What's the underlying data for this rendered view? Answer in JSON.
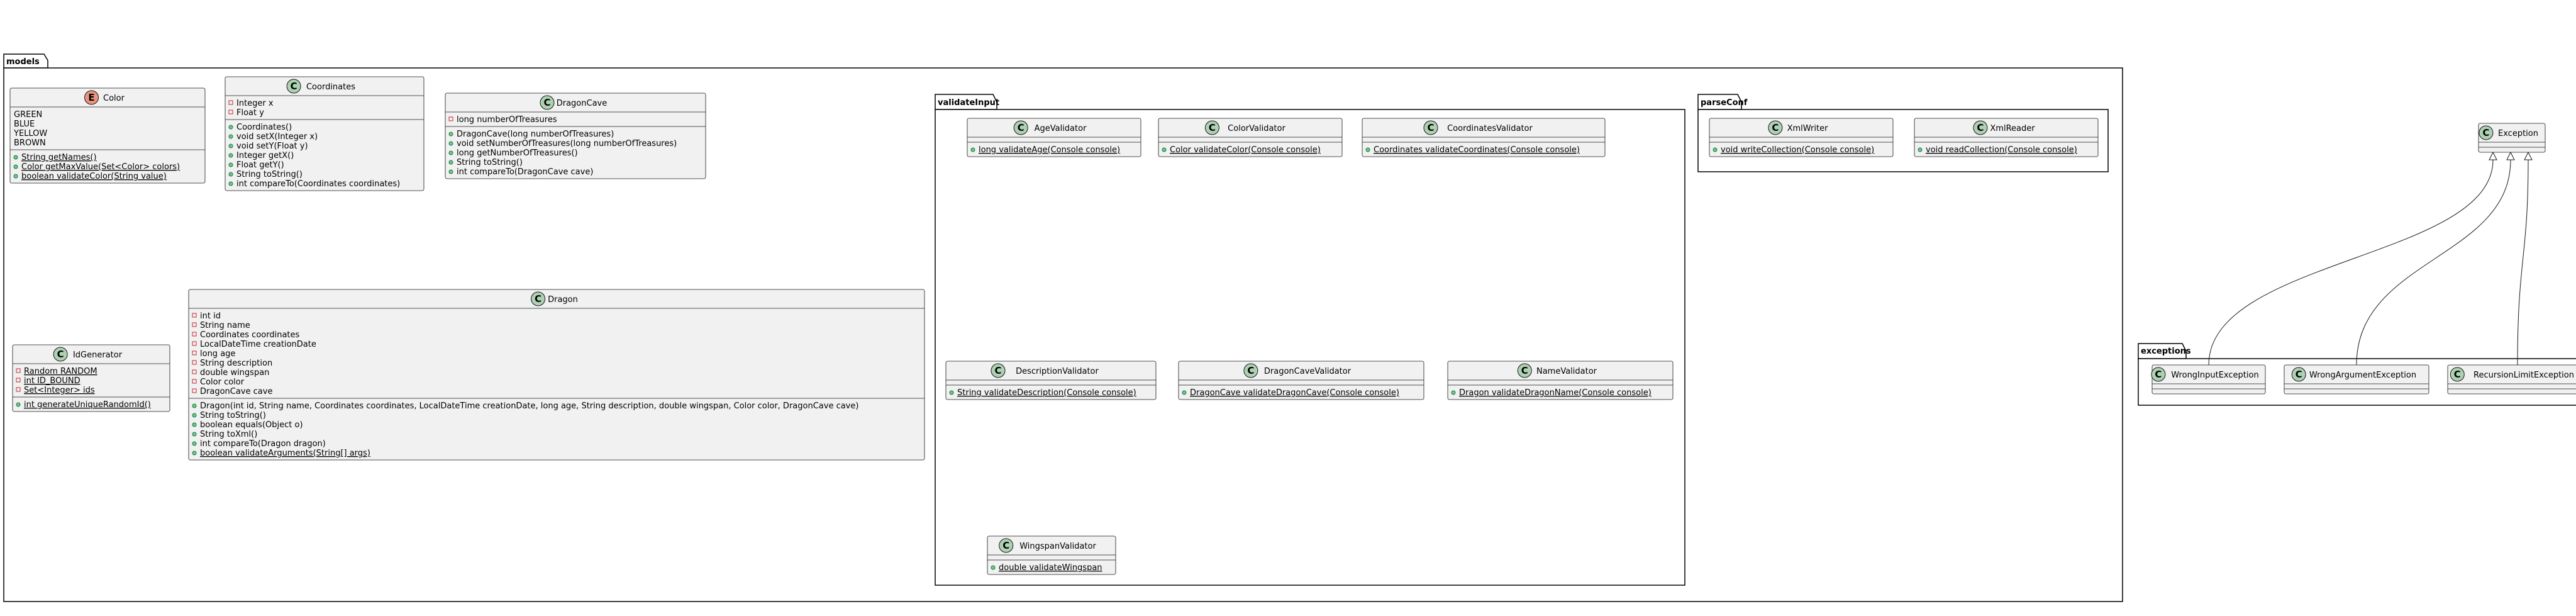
{
  "packages": {
    "models": "models",
    "validateInput": "validateInput",
    "parseConf": "parseConf",
    "exceptions": "exceptions"
  },
  "classes": [
    {
      "id": "color",
      "name": "Color",
      "kind": "enum",
      "members": [
        {
          "vis": "",
          "text": "GREEN"
        },
        {
          "vis": "",
          "text": "BLUE"
        },
        {
          "vis": "",
          "text": "YELLOW"
        },
        {
          "vis": "",
          "text": "BROWN"
        }
      ],
      "methods": [
        {
          "vis": "+",
          "text": "String getNames()",
          "static": true
        },
        {
          "vis": "+",
          "text": "Color getMaxValue(Set<Color> colors)",
          "static": true
        },
        {
          "vis": "+",
          "text": "boolean validateColor(String value)",
          "static": true
        }
      ]
    },
    {
      "id": "coordinates",
      "name": "Coordinates",
      "kind": "class",
      "members": [
        {
          "vis": "-",
          "text": "Integer x"
        },
        {
          "vis": "-",
          "text": "Float y"
        }
      ],
      "methods": [
        {
          "vis": "+",
          "text": "Coordinates()"
        },
        {
          "vis": "+",
          "text": "void setX(Integer x)"
        },
        {
          "vis": "+",
          "text": "void setY(Float y)"
        },
        {
          "vis": "+",
          "text": "Integer getX()"
        },
        {
          "vis": "+",
          "text": "Float getY()"
        },
        {
          "vis": "+",
          "text": "String toString()"
        },
        {
          "vis": "+",
          "text": "int compareTo(Coordinates coordinates)"
        }
      ]
    },
    {
      "id": "dragoncave",
      "name": "DragonCave",
      "kind": "class",
      "members": [
        {
          "vis": "-",
          "text": "long numberOfTreasures"
        }
      ],
      "methods": [
        {
          "vis": "+",
          "text": "DragonCave(long numberOfTreasures)"
        },
        {
          "vis": "+",
          "text": "void setNumberOfTreasures(long numberOfTreasures)"
        },
        {
          "vis": "+",
          "text": "long getNumberOfTreasures()"
        },
        {
          "vis": "+",
          "text": "String toString()"
        },
        {
          "vis": "+",
          "text": "int compareTo(DragonCave cave)"
        }
      ]
    },
    {
      "id": "idgenerator",
      "name": "IdGenerator",
      "kind": "class",
      "members": [
        {
          "vis": "-",
          "text": "Random RANDOM",
          "static": true
        },
        {
          "vis": "-",
          "text": "int ID_BOUND",
          "static": true
        },
        {
          "vis": "-",
          "text": "Set<Integer> ids",
          "static": true
        }
      ],
      "methods": [
        {
          "vis": "+",
          "text": "int generateUniqueRandomId()",
          "static": true
        }
      ]
    },
    {
      "id": "dragon",
      "name": "Dragon",
      "kind": "class",
      "members": [
        {
          "vis": "-",
          "text": "int id"
        },
        {
          "vis": "-",
          "text": "String name"
        },
        {
          "vis": "-",
          "text": "Coordinates coordinates"
        },
        {
          "vis": "-",
          "text": "LocalDateTime creationDate"
        },
        {
          "vis": "-",
          "text": "long age"
        },
        {
          "vis": "-",
          "text": "String description"
        },
        {
          "vis": "-",
          "text": "double wingspan"
        },
        {
          "vis": "-",
          "text": "Color color"
        },
        {
          "vis": "-",
          "text": "DragonCave cave"
        }
      ],
      "methods": [
        {
          "vis": "+",
          "text": "Dragon(int id, String name, Coordinates coordinates, LocalDateTime creationDate, long age, String description, double wingspan, Color color, DragonCave cave)"
        },
        {
          "vis": "+",
          "text": "String toString()"
        },
        {
          "vis": "+",
          "text": "boolean equals(Object o)"
        },
        {
          "vis": "+",
          "text": "String toXml()"
        },
        {
          "vis": "+",
          "text": "int compareTo(Dragon dragon)"
        },
        {
          "vis": "+",
          "text": "boolean validateArguments(String[] args)",
          "static": true
        }
      ]
    },
    {
      "id": "agevalidator",
      "name": "AgeValidator",
      "kind": "class",
      "members": [],
      "methods": [
        {
          "vis": "+",
          "text": "long validateAge(Console console)",
          "static": true
        }
      ]
    },
    {
      "id": "colorvalidator",
      "name": "ColorValidator",
      "kind": "class",
      "members": [],
      "methods": [
        {
          "vis": "+",
          "text": "Color validateColor(Console console)",
          "static": true
        }
      ]
    },
    {
      "id": "coordinatesvalidator",
      "name": "CoordinatesValidator",
      "kind": "class",
      "members": [],
      "methods": [
        {
          "vis": "+",
          "text": "Coordinates validateCoordinates(Console console)",
          "static": true
        }
      ]
    },
    {
      "id": "descriptionvalidator",
      "name": "DescriptionValidator",
      "kind": "class",
      "members": [],
      "methods": [
        {
          "vis": "+",
          "text": "String validateDescription(Console console)",
          "static": true
        }
      ]
    },
    {
      "id": "dragoncavevalidator",
      "name": "DragonCaveValidator",
      "kind": "class",
      "members": [],
      "methods": [
        {
          "vis": "+",
          "text": "DragonCave validateDragonCave(Console console)",
          "static": true
        }
      ]
    },
    {
      "id": "namevalidator",
      "name": "NameValidator",
      "kind": "class",
      "members": [],
      "methods": [
        {
          "vis": "+",
          "text": "Dragon validateDragonName(Console console)",
          "static": true
        }
      ]
    },
    {
      "id": "wingspanvalidator",
      "name": "WingspanValidator",
      "kind": "class",
      "members": [],
      "methods": [
        {
          "vis": "+",
          "text": "double validateWingspan",
          "static": true
        }
      ]
    },
    {
      "id": "xmlwriter",
      "name": "XmlWriter",
      "kind": "class",
      "members": [],
      "methods": [
        {
          "vis": "+",
          "text": "void writeCollection(Console console)",
          "static": true
        }
      ]
    },
    {
      "id": "xmlreader",
      "name": "XmlReader",
      "kind": "class",
      "members": [],
      "methods": [
        {
          "vis": "+",
          "text": "void readCollection(Console console)",
          "static": true
        }
      ]
    },
    {
      "id": "exception",
      "name": "Exception",
      "kind": "class",
      "members": [],
      "methods": []
    },
    {
      "id": "wronginputexception",
      "name": "WrongInputException",
      "kind": "class",
      "members": [],
      "methods": []
    },
    {
      "id": "wrongargumentexception",
      "name": "WrongArgumentException",
      "kind": "class",
      "members": [],
      "methods": []
    },
    {
      "id": "recursionlimitexception",
      "name": "RecursionLimitException",
      "kind": "class",
      "members": [],
      "methods": []
    }
  ],
  "inheritance": [
    {
      "child": "wronginputexception",
      "parent": "exception"
    },
    {
      "child": "wrongargumentexception",
      "parent": "exception"
    },
    {
      "child": "recursionlimitexception",
      "parent": "exception"
    }
  ],
  "colors": {
    "class_fill": "#f1f1f1",
    "class_badge": "#add1b2",
    "enum_badge": "#eb937f",
    "private_marker": "#c82930",
    "public_marker": "#84be84"
  }
}
